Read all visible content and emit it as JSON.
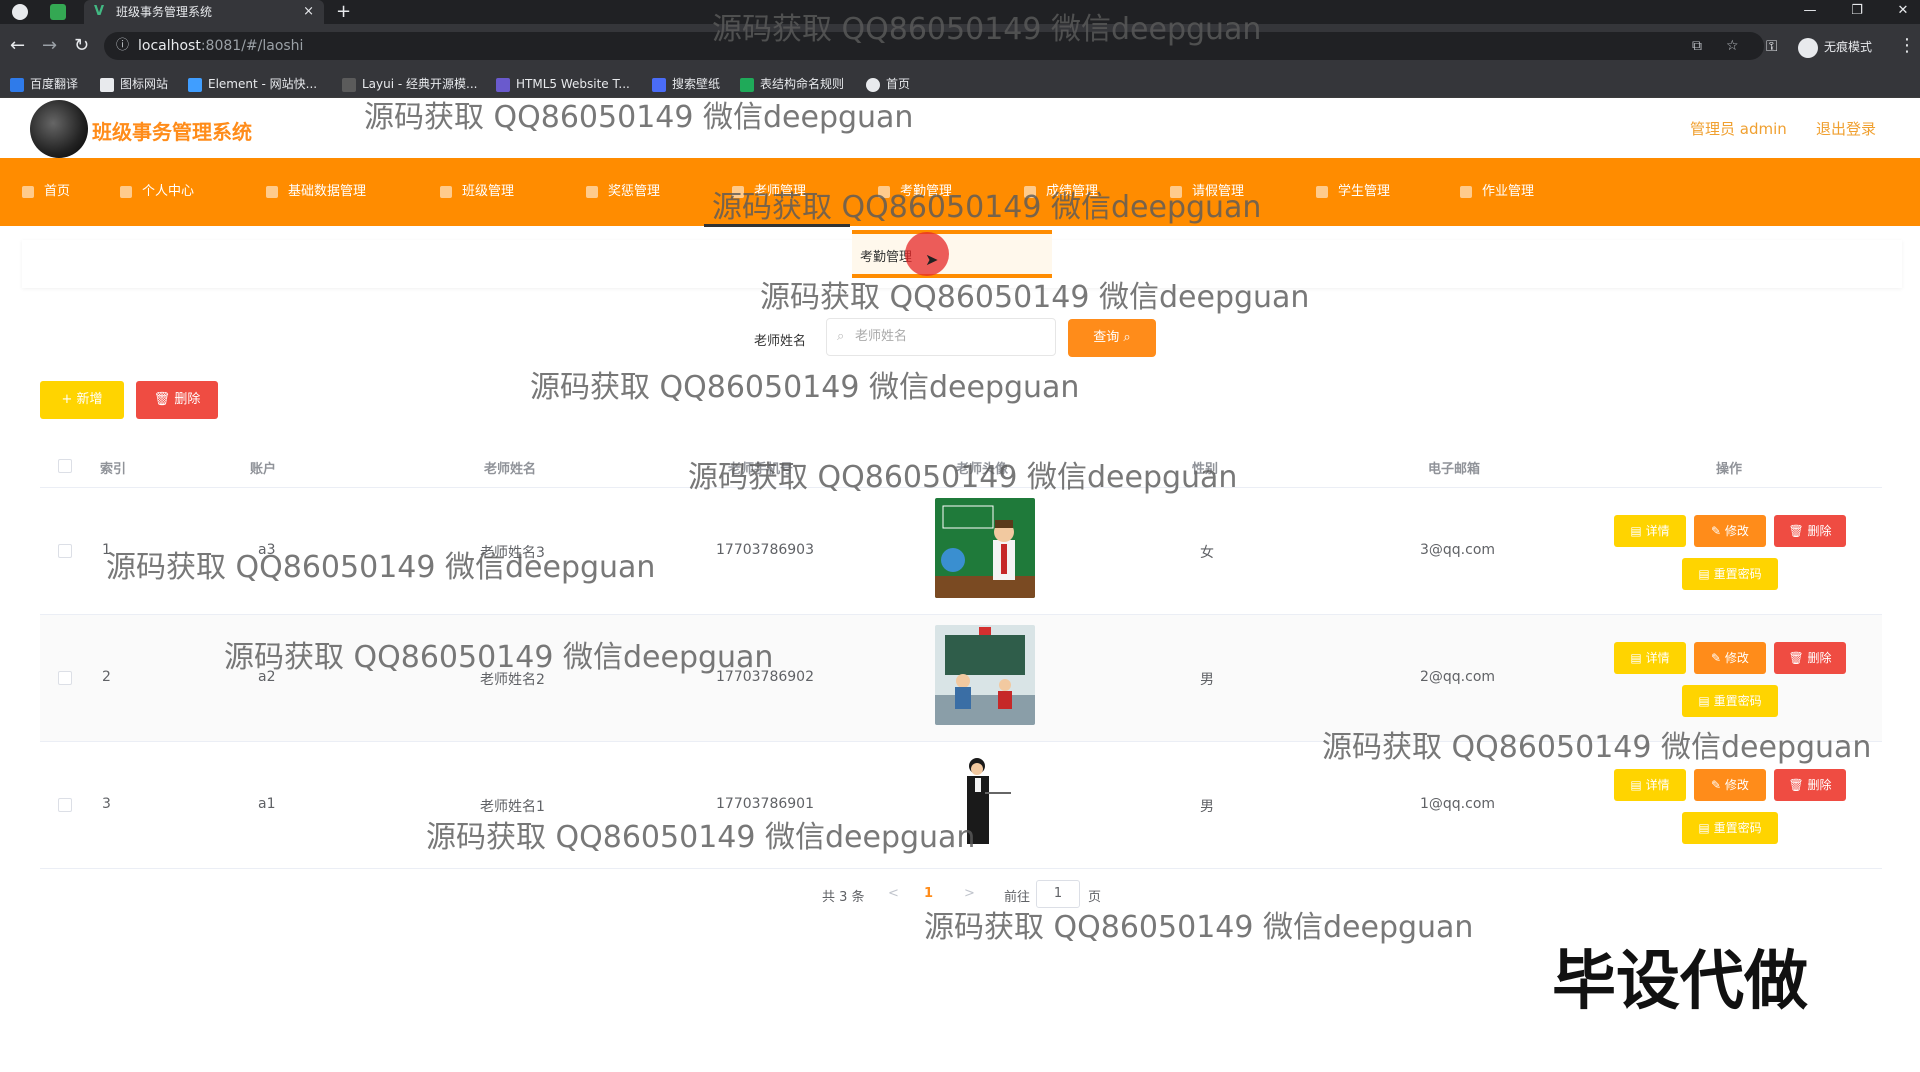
{
  "browser": {
    "tab_title": "班级事务管理系统",
    "tab_close": "×",
    "new_tab": "+",
    "url_host": "localhost",
    "url_path": ":8081/#/laoshi",
    "incognito_label": "无痕模式",
    "bookmarks": [
      "百度翻译",
      "图标网站",
      "Element - 网站快...",
      "Layui - 经典开源模...",
      "HTML5 Website T...",
      "搜索壁纸",
      "表结构命名规则",
      "首页"
    ]
  },
  "header": {
    "title": "班级事务管理系统",
    "user": "管理员 admin",
    "logout": "退出登录"
  },
  "nav": {
    "items": [
      "首页",
      "个人中心",
      "基础数据管理",
      "班级管理",
      "奖惩管理",
      "老师管理",
      "考勤管理",
      "成绩管理",
      "请假管理",
      "学生管理",
      "作业管理"
    ],
    "active_index": 5,
    "submenu_item": "考勤管理"
  },
  "search": {
    "label": "老师姓名",
    "placeholder": "老师姓名",
    "button": "查询"
  },
  "actions": {
    "add": "+ 新增",
    "delete": "删除"
  },
  "table": {
    "columns": [
      "索引",
      "账户",
      "老师姓名",
      "老师手机号",
      "老师头像",
      "性别",
      "电子邮箱",
      "操作"
    ],
    "rows": [
      {
        "index": "1",
        "account": "a3",
        "name": "老师姓名3",
        "phone": "17703786903",
        "gender": "女",
        "email": "3@qq.com"
      },
      {
        "index": "2",
        "account": "a2",
        "name": "老师姓名2",
        "phone": "17703786902",
        "gender": "男",
        "email": "2@qq.com"
      },
      {
        "index": "3",
        "account": "a1",
        "name": "老师姓名1",
        "phone": "17703786901",
        "gender": "男",
        "email": "1@qq.com"
      }
    ],
    "row_actions": {
      "detail": "详情",
      "edit": "修改",
      "delete": "删除",
      "reset": "重置密码"
    }
  },
  "pagination": {
    "total": "共 3 条",
    "prev": "<",
    "current": "1",
    "next": ">",
    "goto": "前往",
    "goto_value": "1",
    "page_unit": "页"
  },
  "watermark": "源码获取 QQ86050149 微信deepguan",
  "stamp": "毕设代做",
  "colors": {
    "brand": "#ff8c00",
    "primary_button": "#ff8c1a",
    "warning_button": "#ffd400",
    "danger_button": "#ef4c42"
  }
}
